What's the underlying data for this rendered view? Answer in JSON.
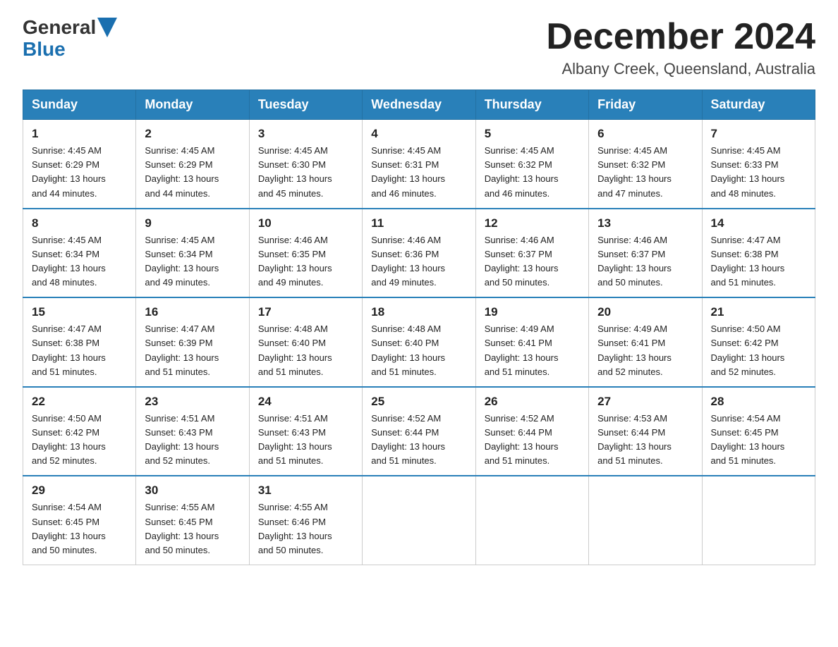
{
  "header": {
    "logo_general": "General",
    "logo_blue": "Blue",
    "month_title": "December 2024",
    "location": "Albany Creek, Queensland, Australia"
  },
  "days_of_week": [
    "Sunday",
    "Monday",
    "Tuesday",
    "Wednesday",
    "Thursday",
    "Friday",
    "Saturday"
  ],
  "weeks": [
    [
      {
        "day": "1",
        "sunrise": "4:45 AM",
        "sunset": "6:29 PM",
        "daylight": "13 hours and 44 minutes."
      },
      {
        "day": "2",
        "sunrise": "4:45 AM",
        "sunset": "6:29 PM",
        "daylight": "13 hours and 44 minutes."
      },
      {
        "day": "3",
        "sunrise": "4:45 AM",
        "sunset": "6:30 PM",
        "daylight": "13 hours and 45 minutes."
      },
      {
        "day": "4",
        "sunrise": "4:45 AM",
        "sunset": "6:31 PM",
        "daylight": "13 hours and 46 minutes."
      },
      {
        "day": "5",
        "sunrise": "4:45 AM",
        "sunset": "6:32 PM",
        "daylight": "13 hours and 46 minutes."
      },
      {
        "day": "6",
        "sunrise": "4:45 AM",
        "sunset": "6:32 PM",
        "daylight": "13 hours and 47 minutes."
      },
      {
        "day": "7",
        "sunrise": "4:45 AM",
        "sunset": "6:33 PM",
        "daylight": "13 hours and 48 minutes."
      }
    ],
    [
      {
        "day": "8",
        "sunrise": "4:45 AM",
        "sunset": "6:34 PM",
        "daylight": "13 hours and 48 minutes."
      },
      {
        "day": "9",
        "sunrise": "4:45 AM",
        "sunset": "6:34 PM",
        "daylight": "13 hours and 49 minutes."
      },
      {
        "day": "10",
        "sunrise": "4:46 AM",
        "sunset": "6:35 PM",
        "daylight": "13 hours and 49 minutes."
      },
      {
        "day": "11",
        "sunrise": "4:46 AM",
        "sunset": "6:36 PM",
        "daylight": "13 hours and 49 minutes."
      },
      {
        "day": "12",
        "sunrise": "4:46 AM",
        "sunset": "6:37 PM",
        "daylight": "13 hours and 50 minutes."
      },
      {
        "day": "13",
        "sunrise": "4:46 AM",
        "sunset": "6:37 PM",
        "daylight": "13 hours and 50 minutes."
      },
      {
        "day": "14",
        "sunrise": "4:47 AM",
        "sunset": "6:38 PM",
        "daylight": "13 hours and 51 minutes."
      }
    ],
    [
      {
        "day": "15",
        "sunrise": "4:47 AM",
        "sunset": "6:38 PM",
        "daylight": "13 hours and 51 minutes."
      },
      {
        "day": "16",
        "sunrise": "4:47 AM",
        "sunset": "6:39 PM",
        "daylight": "13 hours and 51 minutes."
      },
      {
        "day": "17",
        "sunrise": "4:48 AM",
        "sunset": "6:40 PM",
        "daylight": "13 hours and 51 minutes."
      },
      {
        "day": "18",
        "sunrise": "4:48 AM",
        "sunset": "6:40 PM",
        "daylight": "13 hours and 51 minutes."
      },
      {
        "day": "19",
        "sunrise": "4:49 AM",
        "sunset": "6:41 PM",
        "daylight": "13 hours and 51 minutes."
      },
      {
        "day": "20",
        "sunrise": "4:49 AM",
        "sunset": "6:41 PM",
        "daylight": "13 hours and 52 minutes."
      },
      {
        "day": "21",
        "sunrise": "4:50 AM",
        "sunset": "6:42 PM",
        "daylight": "13 hours and 52 minutes."
      }
    ],
    [
      {
        "day": "22",
        "sunrise": "4:50 AM",
        "sunset": "6:42 PM",
        "daylight": "13 hours and 52 minutes."
      },
      {
        "day": "23",
        "sunrise": "4:51 AM",
        "sunset": "6:43 PM",
        "daylight": "13 hours and 52 minutes."
      },
      {
        "day": "24",
        "sunrise": "4:51 AM",
        "sunset": "6:43 PM",
        "daylight": "13 hours and 51 minutes."
      },
      {
        "day": "25",
        "sunrise": "4:52 AM",
        "sunset": "6:44 PM",
        "daylight": "13 hours and 51 minutes."
      },
      {
        "day": "26",
        "sunrise": "4:52 AM",
        "sunset": "6:44 PM",
        "daylight": "13 hours and 51 minutes."
      },
      {
        "day": "27",
        "sunrise": "4:53 AM",
        "sunset": "6:44 PM",
        "daylight": "13 hours and 51 minutes."
      },
      {
        "day": "28",
        "sunrise": "4:54 AM",
        "sunset": "6:45 PM",
        "daylight": "13 hours and 51 minutes."
      }
    ],
    [
      {
        "day": "29",
        "sunrise": "4:54 AM",
        "sunset": "6:45 PM",
        "daylight": "13 hours and 50 minutes."
      },
      {
        "day": "30",
        "sunrise": "4:55 AM",
        "sunset": "6:45 PM",
        "daylight": "13 hours and 50 minutes."
      },
      {
        "day": "31",
        "sunrise": "4:55 AM",
        "sunset": "6:46 PM",
        "daylight": "13 hours and 50 minutes."
      },
      null,
      null,
      null,
      null
    ]
  ],
  "labels": {
    "sunrise": "Sunrise:",
    "sunset": "Sunset:",
    "daylight": "Daylight:"
  }
}
